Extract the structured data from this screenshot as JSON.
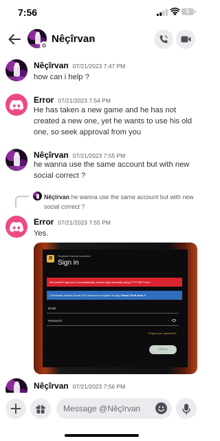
{
  "status_bar": {
    "time": "7:56",
    "battery": "5"
  },
  "header": {
    "contact_name": "Nêçîrvan",
    "chevron": "›"
  },
  "colors": {
    "discord_pink": "#ed4a85",
    "error_red": "#d9242f",
    "info_blue": "#2f6ebd",
    "accent_gold": "#e0a93c"
  },
  "messages": [
    {
      "author": "Nêçîrvan",
      "timestamp": "07/21/2023 7:47 PM",
      "text": "how can i help ?"
    },
    {
      "author": "Error",
      "timestamp": "07/21/2023 7:54 PM",
      "text": "He has taken a new game and he has not created a new one, yet he wants to use his old one, so seek approval from you"
    },
    {
      "author": "Nêçîrvan",
      "timestamp": "07/21/2023 7:55 PM",
      "text": "he wanna use the same account but with new social correct ?"
    },
    {
      "author": "Error",
      "timestamp": "07/21/2023 7:55 PM",
      "text": "Yes.",
      "reply": {
        "author": "Nêçîrvan",
        "text": "he wanna use the same account but with new social correct ?"
      }
    },
    {
      "author": "Nêçîrvan",
      "timestamp": "07/21/2023 7:56 PM"
    }
  ],
  "attachment": {
    "logo_letter": "R",
    "launcher_label": "Rockstar Games Launcher",
    "title": "Sign in",
    "error_text": "We couldn't sign you in automatically, please login manually using r*******@**l.com",
    "info_text": "A Rockstar Games Social Club account is required to play",
    "info_game": "Grand Theft Auto V",
    "email_label": "Email",
    "password_label": "Password",
    "forgot_label": "Forgot your password?",
    "signin_button": "SIGN IN"
  },
  "composer": {
    "placeholder": "Message @Nêçîrvan"
  }
}
